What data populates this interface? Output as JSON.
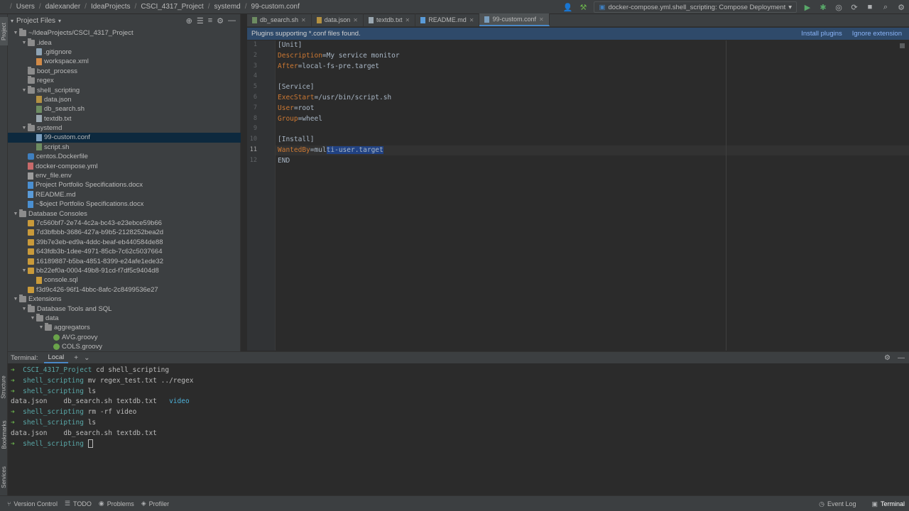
{
  "breadcrumbs": [
    "Users",
    "dalexander",
    "IdeaProjects",
    "CSCI_4317_Project",
    "systemd",
    "99-custom.conf"
  ],
  "run_config": "docker-compose.yml.shell_scripting: Compose Deployment",
  "left_strip": {
    "project": "Project",
    "structure": "Structure",
    "bookmarks": "Bookmarks",
    "services": "Services"
  },
  "project_panel": {
    "title": "Project Files",
    "tree": [
      {
        "label": "~/IdeaProjects/CSCI_4317_Project",
        "depth": 0,
        "type": "folder",
        "open": true
      },
      {
        "label": ".idea",
        "depth": 1,
        "type": "folder",
        "open": true
      },
      {
        "label": ".gitignore",
        "depth": 2,
        "type": "file"
      },
      {
        "label": "workspace.xml",
        "depth": 2,
        "type": "xml"
      },
      {
        "label": "boot_process",
        "depth": 1,
        "type": "folder",
        "open": null
      },
      {
        "label": "regex",
        "depth": 1,
        "type": "folder",
        "open": null
      },
      {
        "label": "shell_scripting",
        "depth": 1,
        "type": "folder",
        "open": true
      },
      {
        "label": "data.json",
        "depth": 2,
        "type": "json"
      },
      {
        "label": "db_search.sh",
        "depth": 2,
        "type": "sh"
      },
      {
        "label": "textdb.txt",
        "depth": 2,
        "type": "txt"
      },
      {
        "label": "systemd",
        "depth": 1,
        "type": "folder",
        "open": true
      },
      {
        "label": "99-custom.conf",
        "depth": 2,
        "type": "conf",
        "selected": true
      },
      {
        "label": "script.sh",
        "depth": 2,
        "type": "sh"
      },
      {
        "label": "centos.Dockerfile",
        "depth": 1,
        "type": "docker"
      },
      {
        "label": "docker-compose.yml",
        "depth": 1,
        "type": "yml"
      },
      {
        "label": "env_file.env",
        "depth": 1,
        "type": "env"
      },
      {
        "label": "Project Portfolio Specifications.docx",
        "depth": 1,
        "type": "docx"
      },
      {
        "label": "README.md",
        "depth": 1,
        "type": "md"
      },
      {
        "label": "~$oject Portfolio Specifications.docx",
        "depth": 1,
        "type": "docx"
      },
      {
        "label": "Database Consoles",
        "depth": 0,
        "type": "folder",
        "open": true
      },
      {
        "label": "7c560bf7-2e74-4c2a-bc43-e23ebce59b66",
        "depth": 1,
        "type": "db"
      },
      {
        "label": "7d3bfbbb-3686-427a-b9b5-2128252bea2d",
        "depth": 1,
        "type": "db"
      },
      {
        "label": "39b7e3eb-ed9a-4ddc-beaf-eb440584de88",
        "depth": 1,
        "type": "db"
      },
      {
        "label": "643fdb3b-1dee-4971-85cb-7c62c5037664",
        "depth": 1,
        "type": "db"
      },
      {
        "label": "16189887-b5ba-4851-8399-e24afe1ede32",
        "depth": 1,
        "type": "db"
      },
      {
        "label": "bb22ef0a-0004-49b8-91cd-f7df5c9404d8",
        "depth": 1,
        "type": "db",
        "open": true
      },
      {
        "label": "console.sql",
        "depth": 2,
        "type": "sql"
      },
      {
        "label": "f3d9c426-96f1-4bbc-8afc-2c8499536e27",
        "depth": 1,
        "type": "db"
      },
      {
        "label": "Extensions",
        "depth": 0,
        "type": "folder",
        "open": true
      },
      {
        "label": "Database Tools and SQL",
        "depth": 1,
        "type": "folder",
        "open": true
      },
      {
        "label": "data",
        "depth": 2,
        "type": "folder",
        "open": true
      },
      {
        "label": "aggregators",
        "depth": 3,
        "type": "folder",
        "open": true
      },
      {
        "label": "AVG.groovy",
        "depth": 4,
        "type": "groovy"
      },
      {
        "label": "COLS.groovy",
        "depth": 4,
        "type": "groovy"
      }
    ]
  },
  "tabs": [
    {
      "label": "db_search.sh",
      "type": "sh",
      "active": false
    },
    {
      "label": "data.json",
      "type": "json",
      "active": false
    },
    {
      "label": "textdb.txt",
      "type": "txt",
      "active": false
    },
    {
      "label": "README.md",
      "type": "md",
      "active": false
    },
    {
      "label": "99-custom.conf",
      "type": "conf",
      "active": true
    }
  ],
  "banner": {
    "message": "Plugins supporting *.conf files found.",
    "install": "Install plugins",
    "ignore": "Ignore extension"
  },
  "editor": {
    "current_line": 11,
    "lines": [
      {
        "n": "1",
        "key": "",
        "val": "[Unit]"
      },
      {
        "n": "2",
        "key": "Description",
        "val": "=My service monitor"
      },
      {
        "n": "3",
        "key": "After",
        "val": "=local-fs-pre.target"
      },
      {
        "n": "4",
        "key": "",
        "val": ""
      },
      {
        "n": "5",
        "key": "",
        "val": "[Service]"
      },
      {
        "n": "6",
        "key": "ExecStart",
        "val": "=/usr/bin/script.sh"
      },
      {
        "n": "7",
        "key": "User",
        "val": "=root"
      },
      {
        "n": "8",
        "key": "Group",
        "val": "=wheel"
      },
      {
        "n": "9",
        "key": "",
        "val": ""
      },
      {
        "n": "10",
        "key": "",
        "val": "[Install]"
      },
      {
        "n": "11",
        "key": "WantedBy",
        "val": "=mul",
        "sel": "ti-user.target"
      },
      {
        "n": "12",
        "key": "",
        "val": "END"
      }
    ]
  },
  "terminal": {
    "title": "Terminal:",
    "tab": "Local",
    "lines": [
      {
        "kind": "prompt",
        "dir": "CSCI_4317_Project",
        "cmd": "cd shell_scripting"
      },
      {
        "kind": "prompt",
        "dir": "shell_scripting",
        "cmd": "mv regex_test.txt ../regex"
      },
      {
        "kind": "prompt",
        "dir": "shell_scripting",
        "cmd": "ls"
      },
      {
        "kind": "out",
        "text": "data.json    db_search.sh textdb.txt   ",
        "extra": "video"
      },
      {
        "kind": "prompt",
        "dir": "shell_scripting",
        "cmd": "rm -rf video"
      },
      {
        "kind": "prompt",
        "dir": "shell_scripting",
        "cmd": "ls"
      },
      {
        "kind": "out",
        "text": "data.json    db_search.sh textdb.txt",
        "extra": ""
      },
      {
        "kind": "prompt",
        "dir": "shell_scripting",
        "cmd": "",
        "cursor": true
      }
    ]
  },
  "statusbar": {
    "left": [
      "Version Control",
      "TODO",
      "Problems",
      "Profiler"
    ],
    "right": [
      "Event Log",
      "Terminal"
    ]
  },
  "colors": {
    "accent": "#4a88c7",
    "selection": "#214283",
    "tree_selection": "#0d293e",
    "keyword": "#cc7832",
    "prompt": "#6ab04c"
  }
}
